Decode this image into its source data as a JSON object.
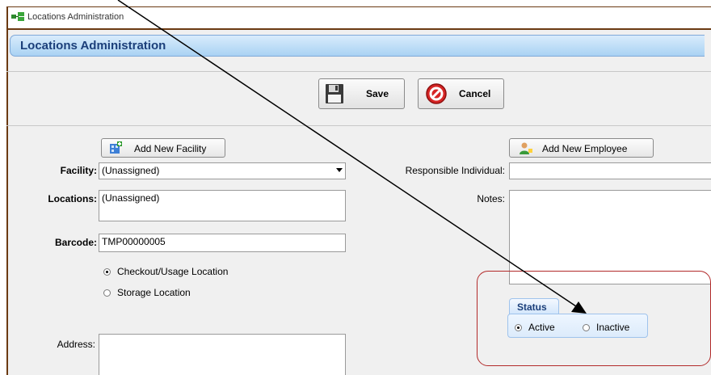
{
  "window": {
    "title": "Locations Administration"
  },
  "header": {
    "title": "Locations Administration"
  },
  "toolbar": {
    "save_label": "Save",
    "cancel_label": "Cancel"
  },
  "form": {
    "add_facility_label": "Add New Facility",
    "add_employee_label": "Add New Employee",
    "facility_label": "Facility:",
    "facility_value": "(Unassigned)",
    "locations_label": "Locations:",
    "locations_value": "(Unassigned)",
    "barcode_label": "Barcode:",
    "barcode_value": "TMP00000005",
    "location_type_options": [
      {
        "label": "Checkout/Usage Location",
        "checked": true
      },
      {
        "label": "Storage Location",
        "checked": false
      }
    ],
    "address_label": "Address:",
    "responsible_label": "Responsible Individual:",
    "notes_label": "Notes:"
  },
  "status": {
    "tab_label": "Status",
    "options": [
      {
        "label": "Active",
        "checked": true
      },
      {
        "label": "Inactive",
        "checked": false
      }
    ]
  },
  "colors": {
    "accent_border": "#6b3a12",
    "header_text": "#1c3f7a",
    "highlight": "#b22a2a"
  }
}
